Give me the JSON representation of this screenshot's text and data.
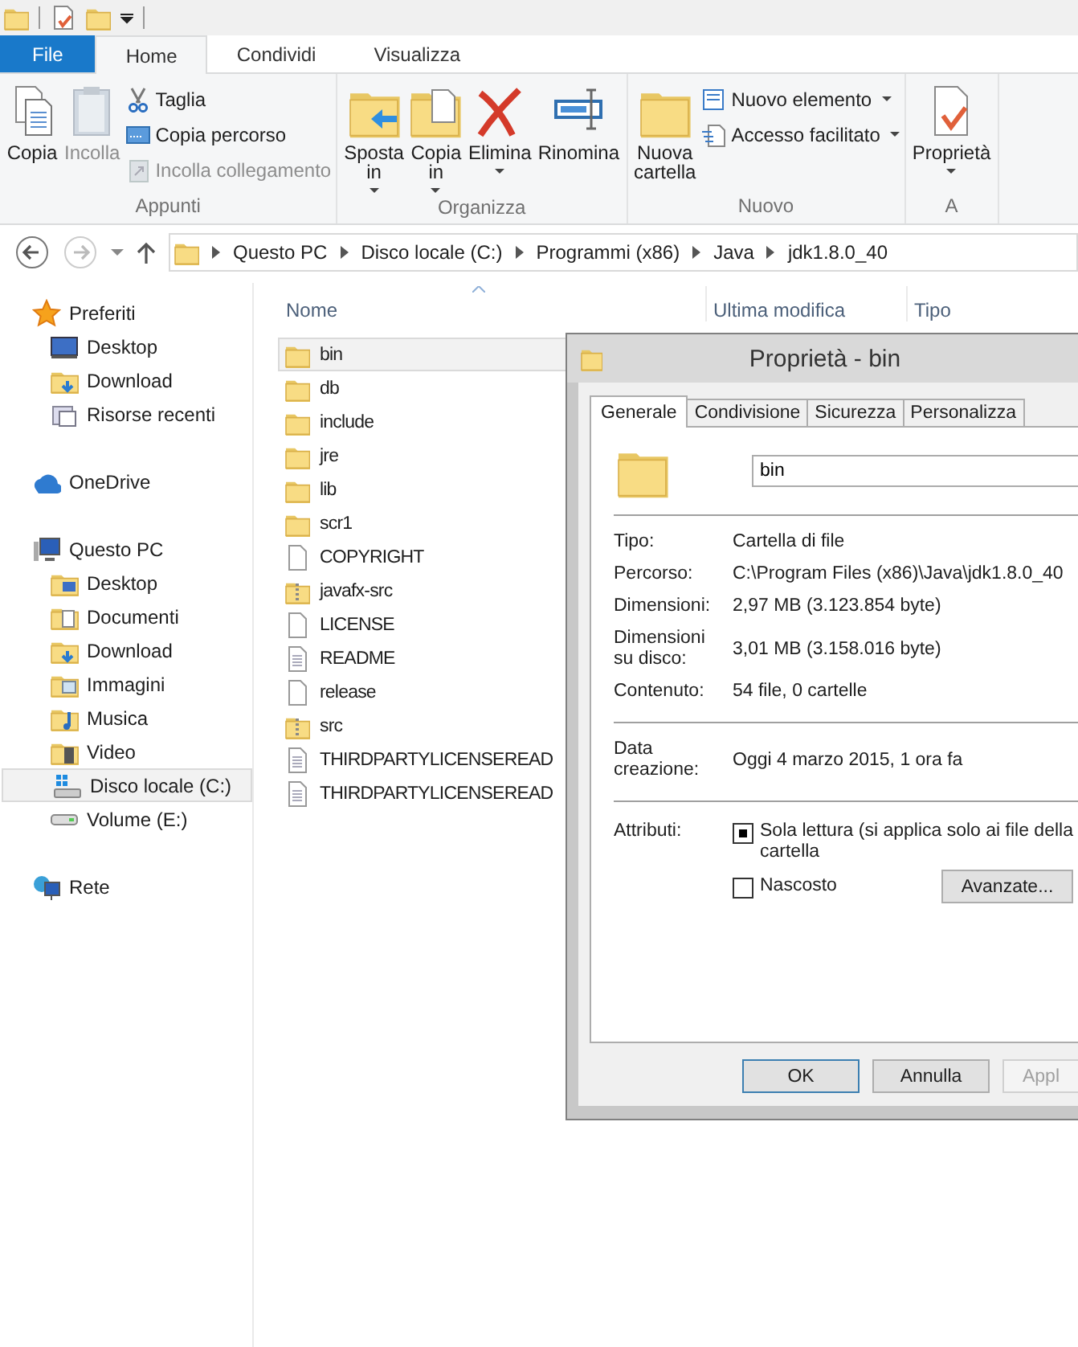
{
  "ribbon_tabs": [
    {
      "label": "File",
      "kind": "file",
      "selected": false
    },
    {
      "label": "Home",
      "kind": "tab",
      "selected": true
    },
    {
      "label": "Condividi",
      "kind": "tab",
      "selected": false
    },
    {
      "label": "Visualizza",
      "kind": "tab",
      "selected": false
    }
  ],
  "ribbon_groups": [
    {
      "label": "Appunti",
      "items": [
        {
          "kind": "large",
          "label": "Copia",
          "disabled": false,
          "dropdown": false
        },
        {
          "kind": "large",
          "label": "Incolla",
          "disabled": true,
          "dropdown": false
        },
        {
          "kind": "small",
          "label": "Taglia",
          "disabled": false,
          "dropdown": false
        },
        {
          "kind": "small",
          "label": "Copia percorso",
          "disabled": false,
          "dropdown": false
        },
        {
          "kind": "small",
          "label": "Incolla collegamento",
          "disabled": true,
          "dropdown": false
        }
      ]
    },
    {
      "label": "Organizza",
      "items": [
        {
          "kind": "large",
          "label": "Sposta in",
          "disabled": false,
          "dropdown": true
        },
        {
          "kind": "large",
          "label": "Copia in",
          "disabled": false,
          "dropdown": true
        },
        {
          "kind": "large",
          "label": "Elimina",
          "disabled": false,
          "dropdown": true
        },
        {
          "kind": "large",
          "label": "Rinomina",
          "disabled": false,
          "dropdown": false
        }
      ]
    },
    {
      "label": "Nuovo",
      "items": [
        {
          "kind": "large",
          "label": "Nuova cartella",
          "disabled": false,
          "dropdown": false
        },
        {
          "kind": "small",
          "label": "Nuovo elemento",
          "disabled": false,
          "dropdown": true
        },
        {
          "kind": "small",
          "label": "Accesso facilitato",
          "disabled": false,
          "dropdown": true
        }
      ]
    },
    {
      "label": "A",
      "items": [
        {
          "kind": "large",
          "label": "Proprietà",
          "disabled": false,
          "dropdown": true
        }
      ]
    }
  ],
  "breadcrumb": [
    "Questo PC",
    "Disco locale (C:)",
    "Programmi (x86)",
    "Java",
    "jdk1.8.0_40"
  ],
  "nav": [
    {
      "label": "Preferiti",
      "selected": false,
      "children": [
        {
          "label": "Desktop",
          "selected": false
        },
        {
          "label": "Download",
          "selected": false
        },
        {
          "label": "Risorse recenti",
          "selected": false
        }
      ]
    },
    {
      "label": "OneDrive",
      "selected": false
    },
    {
      "label": "Questo PC",
      "selected": false,
      "children": [
        {
          "label": "Desktop",
          "selected": false
        },
        {
          "label": "Documenti",
          "selected": false
        },
        {
          "label": "Download",
          "selected": false
        },
        {
          "label": "Immagini",
          "selected": false
        },
        {
          "label": "Musica",
          "selected": false
        },
        {
          "label": "Video",
          "selected": false
        },
        {
          "label": "Disco locale (C:)",
          "selected": true
        },
        {
          "label": "Volume (E:)",
          "selected": false
        }
      ]
    },
    {
      "label": "Rete",
      "selected": false
    }
  ],
  "columns": [
    {
      "label": "Nome",
      "sorted": true
    },
    {
      "label": "Ultima modifica",
      "sorted": false
    },
    {
      "label": "Tipo",
      "sorted": false
    }
  ],
  "files": [
    {
      "name": "bin",
      "kind": "folder",
      "selected": true
    },
    {
      "name": "db",
      "kind": "folder",
      "selected": false
    },
    {
      "name": "include",
      "kind": "folder",
      "selected": false
    },
    {
      "name": "jre",
      "kind": "folder",
      "selected": false
    },
    {
      "name": "lib",
      "kind": "folder",
      "selected": false
    },
    {
      "name": "scr1",
      "kind": "folder",
      "selected": false
    },
    {
      "name": "COPYRIGHT",
      "kind": "file",
      "selected": false
    },
    {
      "name": "javafx-src",
      "kind": "zip",
      "selected": false
    },
    {
      "name": "LICENSE",
      "kind": "file",
      "selected": false
    },
    {
      "name": "README",
      "kind": "text",
      "selected": false
    },
    {
      "name": "release",
      "kind": "file",
      "selected": false
    },
    {
      "name": "src",
      "kind": "zip",
      "selected": false
    },
    {
      "name": "THIRDPARTYLICENSEREAD",
      "kind": "text",
      "selected": false
    },
    {
      "name": "THIRDPARTYLICENSEREAD",
      "kind": "text",
      "selected": false
    }
  ],
  "dialog": {
    "title": "Proprietà - bin",
    "tabs": [
      {
        "label": "Generale",
        "selected": true
      },
      {
        "label": "Condivisione",
        "selected": false
      },
      {
        "label": "Sicurezza",
        "selected": false
      },
      {
        "label": "Personalizza",
        "selected": false
      }
    ],
    "name_value": "bin",
    "sections": [
      [
        {
          "label": "Tipo:",
          "value": "Cartella di file"
        },
        {
          "label": "Percorso:",
          "value": "C:\\Program Files (x86)\\Java\\jdk1.8.0_40"
        },
        {
          "label": "Dimensioni:",
          "value": "2,97 MB (3.123.854 byte)"
        },
        {
          "label": "Dimensioni\nsu disco:",
          "value": "3,01 MB (3.158.016 byte)"
        },
        {
          "label": "Contenuto:",
          "value": "54 file, 0 cartelle"
        }
      ],
      [
        {
          "label": "Data\ncreazione:",
          "value": "Oggi 4 marzo 2015, 1 ora fa"
        }
      ]
    ],
    "attributes_label": "Attributi:",
    "attributes": [
      {
        "label": "Sola lettura (si applica solo ai file della cartella",
        "checked": false,
        "indeterminate": true
      },
      {
        "label": "Nascosto",
        "checked": false,
        "indeterminate": false
      }
    ],
    "advanced_button": "Avanzate...",
    "buttons": [
      {
        "label": "OK",
        "default": true,
        "disabled": false
      },
      {
        "label": "Annulla",
        "default": false,
        "disabled": false
      },
      {
        "label": "Appl",
        "default": false,
        "disabled": true
      }
    ]
  }
}
